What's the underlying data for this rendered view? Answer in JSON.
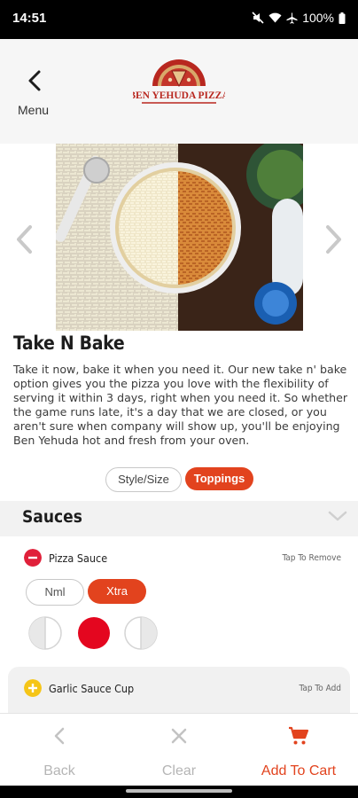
{
  "status_bar": {
    "time": "14:51",
    "battery": "100%",
    "icons": [
      "mute-icon",
      "wifi-icon",
      "airplane-icon",
      "battery-icon"
    ]
  },
  "header": {
    "back_label": "Menu",
    "logo_text": "BEN YEHUDA PIZZA"
  },
  "item": {
    "title": "Take N Bake",
    "description": "Take it now, bake it when you need it. Our new take n' bake option gives you the pizza you love with the flexibility of serving it within 3 days, right when you need it.  So whether the game runs late, it's a day that we are closed, or you aren't sure when company will show up, you'll be enjoying Ben Yehuda hot and fresh from your oven."
  },
  "tabs": [
    {
      "label": "Style/Size",
      "active": false
    },
    {
      "label": "Toppings",
      "active": true
    }
  ],
  "sauces": {
    "title": "Sauces",
    "items": [
      {
        "name": "Pizza Sauce",
        "hint": "Tap To Remove",
        "selected": true,
        "amounts": [
          {
            "label": "Nml",
            "active": false
          },
          {
            "label": "Xtra",
            "active": true
          }
        ],
        "portions": [
          "left-half",
          "whole",
          "right-half"
        ],
        "active_portion": "whole"
      },
      {
        "name": "Garlic Sauce Cup",
        "hint": "Tap To Add",
        "selected": false
      }
    ]
  },
  "bottom_bar": {
    "back": "Back",
    "clear": "Clear",
    "add_to_cart": "Add To Cart"
  },
  "colors": {
    "accent": "#e2431e",
    "remove_icon": "#e0203a",
    "add_icon": "#f5c518",
    "disabled": "#b9b9b9"
  }
}
